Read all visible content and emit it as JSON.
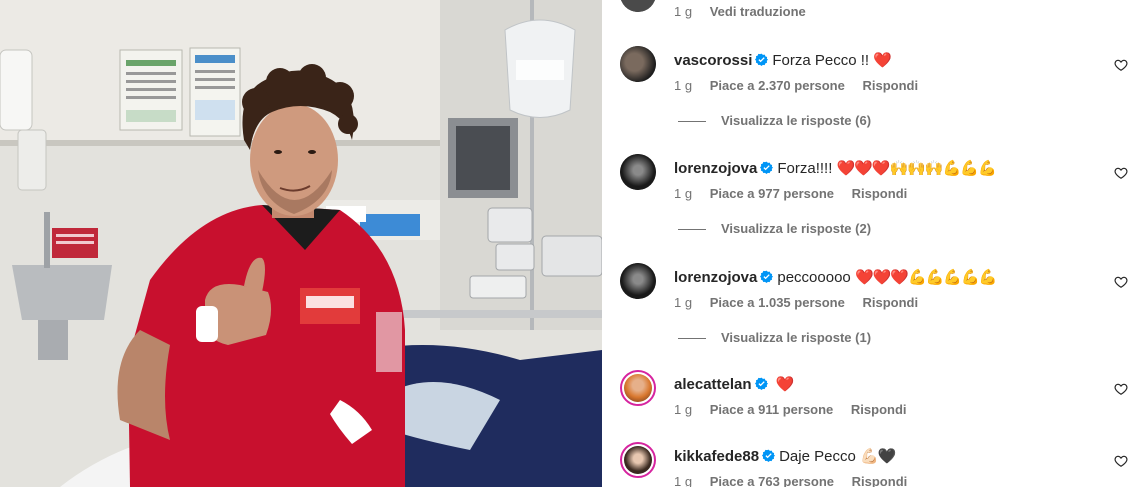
{
  "top_comment": {
    "time": "1 g",
    "translate_label": "Vedi traduzione"
  },
  "comments": [
    {
      "username": "vascorossi",
      "text": "Forza Pecco !!",
      "emoji": "❤️",
      "time": "1 g",
      "likes": "Piace a 2.370 persone",
      "reply": "Rispondi",
      "replies": "Visualizza le risposte (6)"
    },
    {
      "username": "lorenzojova",
      "text": "Forza!!!!",
      "emoji": "❤️❤️❤️🙌🙌🙌💪💪💪",
      "time": "1 g",
      "likes": "Piace a 977 persone",
      "reply": "Rispondi",
      "replies": "Visualizza le risposte (2)"
    },
    {
      "username": "lorenzojova",
      "text": "peccooooo",
      "emoji": "❤️❤️❤️💪💪💪💪💪",
      "time": "1 g",
      "likes": "Piace a 1.035 persone",
      "reply": "Rispondi",
      "replies": "Visualizza le risposte (1)"
    },
    {
      "username": "alecattelan",
      "text": "",
      "emoji": "❤️",
      "time": "1 g",
      "likes": "Piace a 911 persone",
      "reply": "Rispondi"
    },
    {
      "username": "kikkafede88",
      "text": "Daje Pecco",
      "emoji": "💪🏻🖤",
      "time": "1 g",
      "likes": "Piace a 763 persone",
      "reply": "Rispondi"
    }
  ],
  "colors": {
    "verified": "#0095f6",
    "secondary_text": "#737373",
    "heart": "#ed4956"
  },
  "icons": {
    "verified": "verified-badge-icon",
    "like": "heart-outline-icon"
  }
}
